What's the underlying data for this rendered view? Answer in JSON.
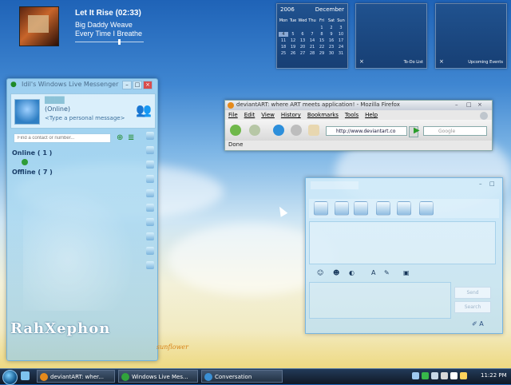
{
  "media": {
    "title": "Let It Rise (02:33)",
    "artist": "Big Daddy Weave",
    "album": "Every Time I Breathe"
  },
  "calendar": {
    "year": "2006",
    "month": "December",
    "days": [
      "Mon",
      "Tue",
      "Wed",
      "Thu",
      "Fri",
      "Sat",
      "Sun"
    ],
    "dates": [
      "",
      "",
      "",
      "",
      "1",
      "2",
      "3",
      "4",
      "5",
      "6",
      "7",
      "8",
      "9",
      "10",
      "11",
      "12",
      "13",
      "14",
      "15",
      "16",
      "17",
      "18",
      "19",
      "20",
      "21",
      "22",
      "23",
      "24",
      "25",
      "26",
      "27",
      "28",
      "29",
      "30",
      "31"
    ],
    "today": "4"
  },
  "gadgets": {
    "todo": "To-Do List",
    "events": "Upcoming Events",
    "close": "×"
  },
  "messenger": {
    "title": "Idil's Windows Live Messenger",
    "status": "(Online)",
    "personal": "<Type a personal message>",
    "search_placeholder": "Find a contact or number...",
    "groups": {
      "online": "Online ( 1 )",
      "offline": "Offline ( 7 )"
    },
    "art_text": "RahXephon"
  },
  "firefox": {
    "title": "deviantART: where ART meets application! - Mozilla Firefox",
    "menu": [
      "File",
      "Edit",
      "View",
      "History",
      "Bookmarks",
      "Tools",
      "Help"
    ],
    "url": "http://www.deviantart.co",
    "search_placeholder": "Google",
    "status": "Done"
  },
  "conversation": {
    "send": "Send",
    "search": "Search"
  },
  "taskbar": {
    "tasks": [
      "deviantART: wher...",
      "Windows Live Mes...",
      "Conversation"
    ],
    "clock": "11:22 PM"
  },
  "desktop": {
    "logo": "sunflower"
  },
  "colors": {
    "accent": "#1f63b7",
    "messenger_bg": "#b8def3",
    "taskbar": "#17273d"
  }
}
